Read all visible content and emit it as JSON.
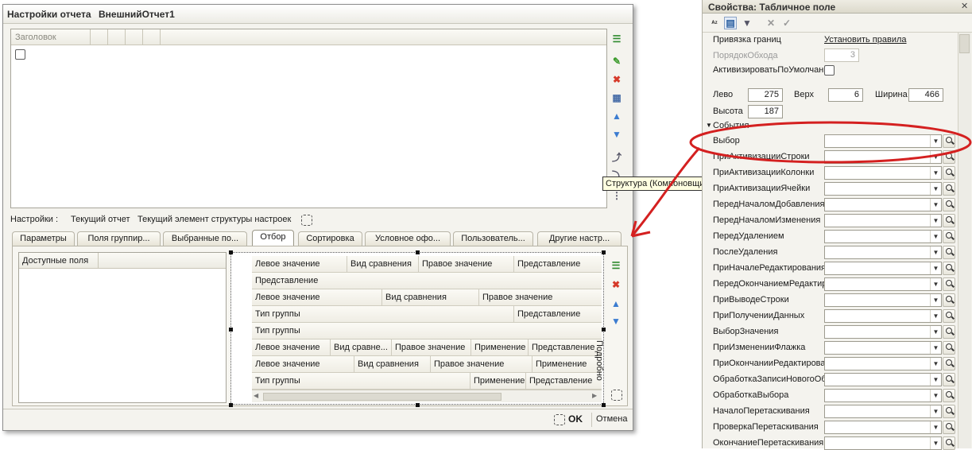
{
  "window": {
    "title_prefix": "Настройки отчета",
    "title_name": "ВнешнийОтчет1"
  },
  "structure_tree": {
    "header": "Заголовок"
  },
  "settings_line": {
    "label": "Настройки :",
    "current_report": "Текущий отчет",
    "current_element": "Текущий элемент структуры настроек"
  },
  "tabs": [
    "Параметры",
    "Поля группир...",
    "Выбранные по...",
    "Отбор",
    "Сортировка",
    "Условное офо...",
    "Пользователь...",
    "Другие настр..."
  ],
  "filter": {
    "available_fields": "Доступные поля",
    "rows": [
      [
        "Левое значение",
        "Вид сравнения",
        "Правое значение",
        "Представление"
      ],
      [
        "Представление"
      ],
      [
        "Левое значение",
        "Вид сравнения",
        "Правое значение"
      ],
      [
        "Тип группы",
        "Представление"
      ],
      [
        "Тип группы"
      ],
      [
        "Левое значение",
        "Вид сравне...",
        "Правое значение",
        "Применение",
        "Представление"
      ],
      [
        "Левое значение",
        "Вид сравнения",
        "Правое значение",
        "Применение"
      ],
      [
        "Тип группы",
        "Применение",
        "Представление"
      ]
    ],
    "detail_label": "Подробно"
  },
  "buttons": {
    "ok": "OK",
    "cancel": "Отмена"
  },
  "tooltip": "Структура (КомпоновщикНастроек.Настройки)",
  "properties": {
    "title": "Свойства: Табличное поле",
    "privyazka_label": "Привязка границ",
    "privyazka_value": "Установить правила",
    "poryadok_label": "ПорядокОбхода",
    "poryadok_value": "3",
    "activate_label": "АктивизироватьПоУмолчанию",
    "left_label": "Лево",
    "left_value": "275",
    "top_label": "Верх",
    "top_value": "6",
    "width_label": "Ширина",
    "width_value": "466",
    "height_label": "Высота",
    "height_value": "187",
    "events_label": "События",
    "events": [
      "Выбор",
      "ПриАктивизацииСтроки",
      "ПриАктивизацииКолонки",
      "ПриАктивизацииЯчейки",
      "ПередНачаломДобавления",
      "ПередНачаломИзменения",
      "ПередУдалением",
      "ПослеУдаления",
      "ПриНачалеРедактирования",
      "ПередОкончаниемРедактирования",
      "ПриВыводеСтроки",
      "ПриПолученииДанных",
      "ВыборЗначения",
      "ПриИзмененииФлажка",
      "ПриОкончанииРедактирования",
      "ОбработкаЗаписиНовогоОбъекта",
      "ОбработкаВыбора",
      "НачалоПеретаскивания",
      "ПроверкаПеретаскивания",
      "ОкончаниеПеретаскивания"
    ]
  },
  "colors": {
    "annotation": "#d42020",
    "tab_active": "#ffffff",
    "link": "#1a1a1a"
  }
}
